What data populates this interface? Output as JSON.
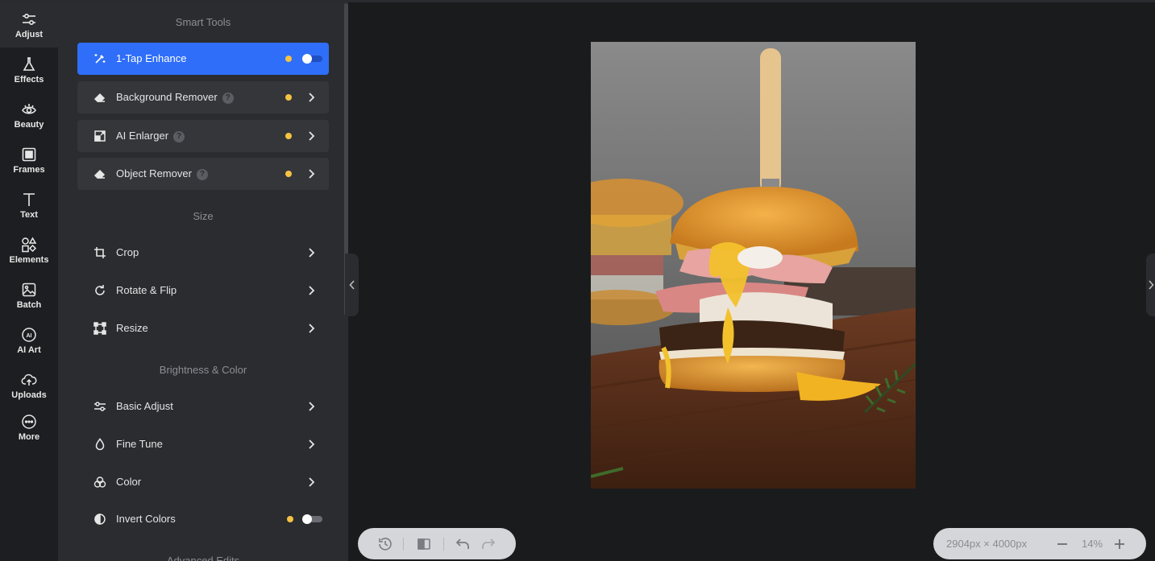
{
  "rail": {
    "items": [
      {
        "label": "Adjust",
        "icon": "sliders-icon",
        "active": true
      },
      {
        "label": "Effects",
        "icon": "flask-icon"
      },
      {
        "label": "Beauty",
        "icon": "eye-icon"
      },
      {
        "label": "Frames",
        "icon": "frame-icon"
      },
      {
        "label": "Text",
        "icon": "text-icon"
      },
      {
        "label": "Elements",
        "icon": "shapes-icon"
      },
      {
        "label": "Batch",
        "icon": "batch-image-icon"
      },
      {
        "label": "AI Art",
        "icon": "ai-icon"
      },
      {
        "label": "Uploads",
        "icon": "upload-cloud-icon"
      },
      {
        "label": "More",
        "icon": "more-icon"
      }
    ]
  },
  "panel": {
    "smart_tools_title": "Smart Tools",
    "smart_tools": [
      {
        "label": "1-Tap Enhance",
        "icon": "magic-wand-icon",
        "active": true,
        "toggle": true
      },
      {
        "label": "Background Remover",
        "icon": "eraser-icon",
        "help": true
      },
      {
        "label": "AI Enlarger",
        "icon": "enlarge-icon",
        "help": true
      },
      {
        "label": "Object Remover",
        "icon": "eraser-icon",
        "help": true
      }
    ],
    "size_title": "Size",
    "size_tools": [
      {
        "label": "Crop",
        "icon": "crop-icon"
      },
      {
        "label": "Rotate & Flip",
        "icon": "rotate-icon"
      },
      {
        "label": "Resize",
        "icon": "resize-icon"
      }
    ],
    "brightness_title": "Brightness & Color",
    "brightness_tools": [
      {
        "label": "Basic Adjust",
        "icon": "sliders-icon"
      },
      {
        "label": "Fine Tune",
        "icon": "droplet-icon"
      },
      {
        "label": "Color",
        "icon": "color-circles-icon"
      },
      {
        "label": "Invert Colors",
        "icon": "invert-icon",
        "toggle": true
      }
    ],
    "advanced_title": "Advanced Edits",
    "help_glyph": "?"
  },
  "canvas": {
    "dimensions": "2904px × 4000px",
    "zoom": "14%"
  },
  "colors": {
    "accent": "#2f6ef8",
    "premium_dot": "#f5c243",
    "panel_bg": "#2b2c30",
    "canvas_bg": "#1a1b1d"
  }
}
